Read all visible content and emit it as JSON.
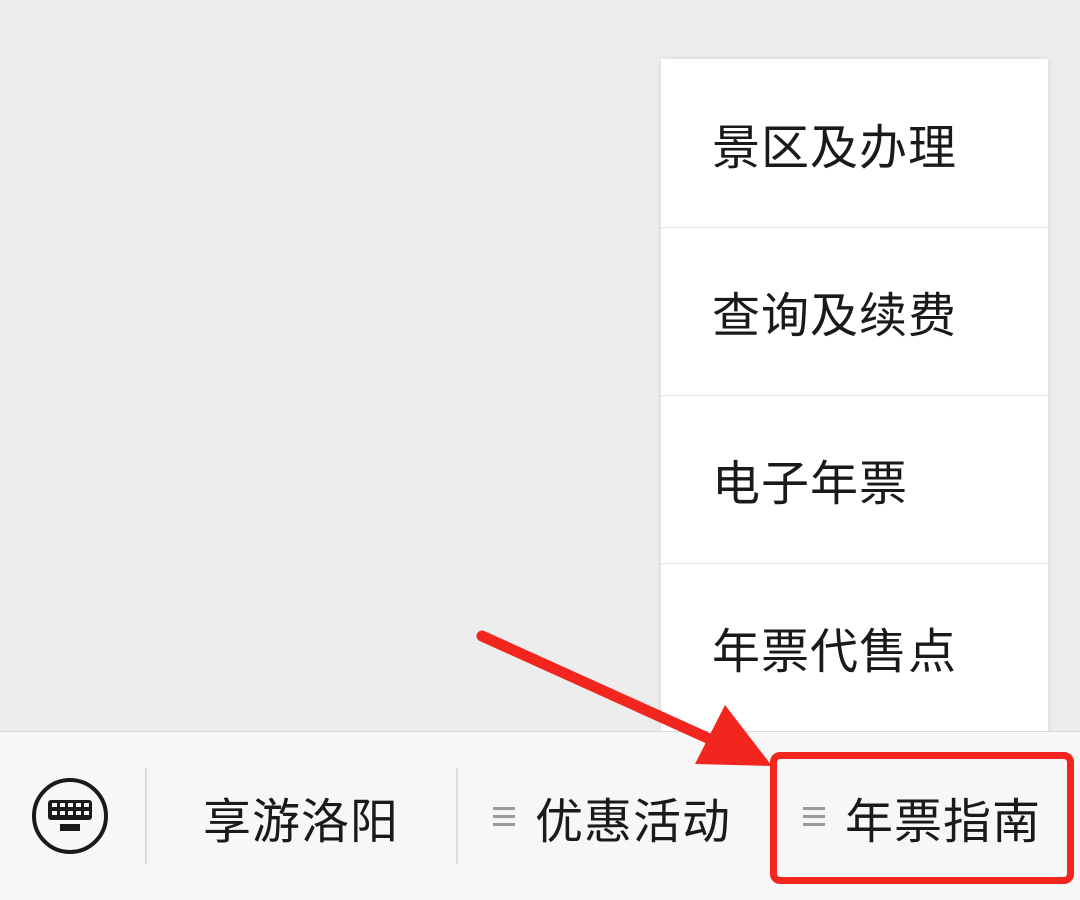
{
  "submenu": {
    "items": [
      {
        "label": "景区及办理"
      },
      {
        "label": "查询及续费"
      },
      {
        "label": "电子年票"
      },
      {
        "label": "年票代售点"
      }
    ]
  },
  "menubar": {
    "keyboard_icon": "keyboard-icon",
    "tabs": [
      {
        "label": "享游洛阳",
        "has_submenu": false
      },
      {
        "label": "优惠活动",
        "has_submenu": true
      },
      {
        "label": "年票指南",
        "has_submenu": true
      }
    ]
  },
  "annotation": {
    "color": "#f2261f"
  }
}
